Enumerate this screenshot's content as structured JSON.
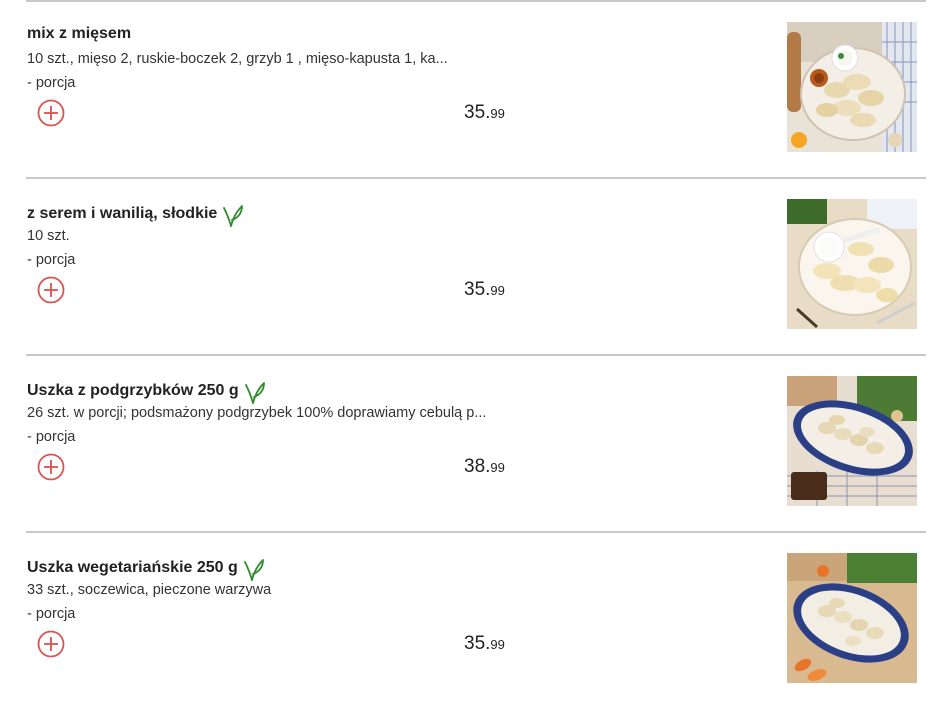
{
  "menu": {
    "items": [
      {
        "name": "mix z mięsem",
        "vegetarian": false,
        "description": "10 szt., mięso 2, ruskie-boczek 2, grzyb 1 , mięso-kapusta 1, ka...",
        "portion": "- porcja",
        "price_main": "35.",
        "price_cents": "99",
        "image": "dumplings-mixed-plate-photo"
      },
      {
        "name": "z serem i wanilią, słodkie",
        "vegetarian": true,
        "description": "10 szt.",
        "portion": "- porcja",
        "price_main": "35.",
        "price_cents": "99",
        "image": "sweet-dumplings-with-cream-photo"
      },
      {
        "name": "Uszka z podgrzybków 250 g",
        "vegetarian": true,
        "description": "26 szt. w porcji; podsmażony podgrzybek 100% doprawiamy cebulą p...",
        "portion": "- porcja",
        "price_main": "38.",
        "price_cents": "99",
        "image": "mushroom-uszka-oval-dish-photo"
      },
      {
        "name": "Uszka wegetariańskie 250 g",
        "vegetarian": true,
        "description": "33 szt., soczewica, pieczone warzywa",
        "portion": "- porcja",
        "price_main": "35.",
        "price_cents": "99",
        "image": "vegetarian-uszka-oval-dish-photo"
      }
    ]
  },
  "icons": {
    "add": "plus-circle-icon",
    "vegetarian": "leaf-icon"
  },
  "colors": {
    "add_icon": "#d9534f",
    "vegetarian_icon": "#2e8b2e",
    "divider": "#c8c8c8",
    "text": "#333333"
  }
}
